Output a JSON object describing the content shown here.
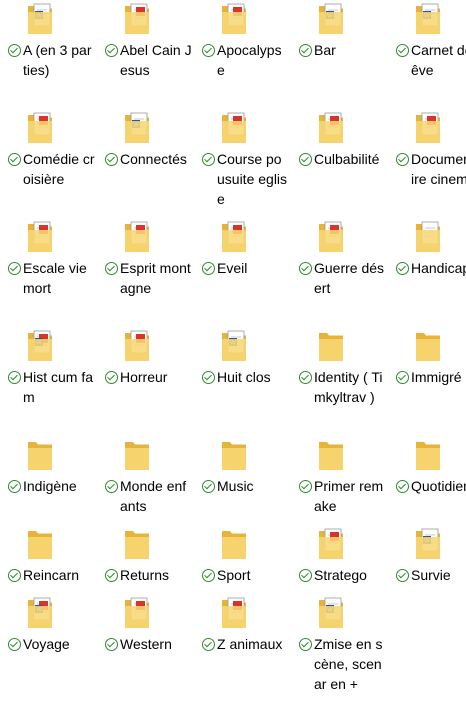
{
  "view": "large-icons",
  "colors": {
    "folder_back": "#e8b339",
    "folder_front": "#f8d775",
    "sync_check": "#2f8a2f",
    "pdf_red": "#d9342b",
    "word_blue": "#2b579a"
  },
  "items": [
    {
      "name": "A (en 3 parties)",
      "icon": "word-folder-icon",
      "synced": true
    },
    {
      "name": "Abel Cain Jesus",
      "icon": "pdf-folder-icon",
      "synced": true
    },
    {
      "name": "Apocalypse",
      "icon": "pdf-folder-icon",
      "synced": true
    },
    {
      "name": "Bar",
      "icon": "word-folder-icon",
      "synced": true
    },
    {
      "name": "Carnet de rêve",
      "icon": "word-folder-icon",
      "synced": true
    },
    {
      "name": "Comédie croisière",
      "icon": "pdf-folder-icon",
      "synced": true
    },
    {
      "name": "Connectés",
      "icon": "word-folder-icon",
      "synced": true
    },
    {
      "name": "Course pousuite eglise",
      "icon": "pdf-folder-icon",
      "synced": true
    },
    {
      "name": "Culbabilité",
      "icon": "pdf-folder-icon",
      "synced": true
    },
    {
      "name": "Documentaire cinema",
      "icon": "pdf-folder-icon",
      "synced": true
    },
    {
      "name": "Escale vie mort",
      "icon": "pdf-folder-icon",
      "synced": true
    },
    {
      "name": "Esprit montagne",
      "icon": "pdf-folder-icon",
      "synced": true
    },
    {
      "name": "Eveil",
      "icon": "pdf-folder-icon",
      "synced": true
    },
    {
      "name": "Guerre désert",
      "icon": "pdf-folder-icon",
      "synced": true
    },
    {
      "name": "Handicap",
      "icon": "doc-folder-icon",
      "synced": true
    },
    {
      "name": "Hist cum fam",
      "icon": "mixed-folder-icon",
      "synced": true
    },
    {
      "name": "Horreur",
      "icon": "pdf-folder-icon",
      "synced": true
    },
    {
      "name": "Huit clos",
      "icon": "word-folder-icon",
      "synced": true
    },
    {
      "name": "Identity ( Timkyltrav )",
      "icon": "folder-icon",
      "synced": true
    },
    {
      "name": "Immigré",
      "icon": "folder-icon",
      "synced": true
    },
    {
      "name": "Indigène",
      "icon": "folder-icon",
      "synced": true
    },
    {
      "name": "Monde enfants",
      "icon": "folder-icon",
      "synced": true
    },
    {
      "name": "Music",
      "icon": "folder-icon",
      "synced": true
    },
    {
      "name": "Primer remake",
      "icon": "folder-icon",
      "synced": true
    },
    {
      "name": "Quotidien",
      "icon": "folder-icon",
      "synced": true
    },
    {
      "name": "Reincarn",
      "icon": "folder-icon",
      "synced": true
    },
    {
      "name": "Returns",
      "icon": "folder-icon",
      "synced": true
    },
    {
      "name": "Sport",
      "icon": "folder-icon",
      "synced": true
    },
    {
      "name": "Stratego",
      "icon": "pdf-folder-icon",
      "synced": true
    },
    {
      "name": "Survie",
      "icon": "word-folder-icon",
      "synced": true
    },
    {
      "name": "Voyage",
      "icon": "mixed-folder-icon",
      "synced": true
    },
    {
      "name": "Western",
      "icon": "pdf-folder-icon",
      "synced": true
    },
    {
      "name": "Z animaux",
      "icon": "pdf-folder-icon",
      "synced": true
    },
    {
      "name": "Zmise en scène, scenar en +",
      "icon": "word-folder-icon",
      "synced": true
    }
  ]
}
